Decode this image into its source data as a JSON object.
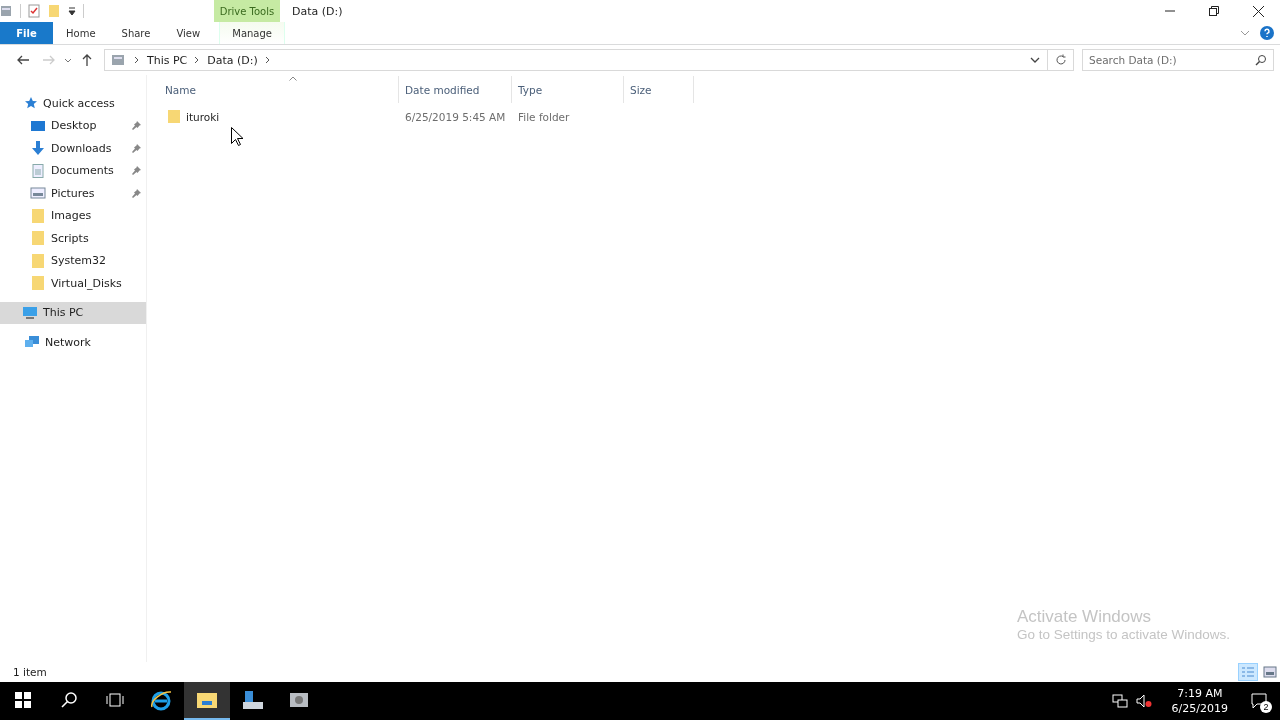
{
  "window": {
    "title": "Data (D:)",
    "context_group": "Drive Tools"
  },
  "tabs": [
    {
      "label": "File",
      "kind": "file",
      "selected": false
    },
    {
      "label": "Home",
      "kind": "plain",
      "selected": false
    },
    {
      "label": "Share",
      "kind": "plain",
      "selected": false
    },
    {
      "label": "View",
      "kind": "plain",
      "selected": false
    },
    {
      "label": "Manage",
      "kind": "context",
      "selected": false
    }
  ],
  "address": {
    "crumbs": [
      "This PC",
      "Data (D:)"
    ]
  },
  "search": {
    "placeholder": "Search Data (D:)"
  },
  "sidebar": {
    "items": [
      {
        "label": "Quick access",
        "kind": "star",
        "selected": false,
        "children": [
          {
            "label": "Desktop",
            "kind": "desktop",
            "pinned": true,
            "selected": false
          },
          {
            "label": "Downloads",
            "kind": "download",
            "pinned": true,
            "selected": false
          },
          {
            "label": "Documents",
            "kind": "document",
            "pinned": true,
            "selected": false
          },
          {
            "label": "Pictures",
            "kind": "picture",
            "pinned": true,
            "selected": false
          },
          {
            "label": "Images",
            "kind": "folder",
            "pinned": false,
            "selected": false
          },
          {
            "label": "Scripts",
            "kind": "folder",
            "pinned": false,
            "selected": false
          },
          {
            "label": "System32",
            "kind": "folder",
            "pinned": false,
            "selected": false
          },
          {
            "label": "Virtual_Disks",
            "kind": "folder",
            "pinned": false,
            "selected": false
          }
        ]
      },
      {
        "label": "This PC",
        "kind": "pc",
        "selected": true
      },
      {
        "label": "Network",
        "kind": "network",
        "selected": false
      }
    ]
  },
  "table": {
    "columns": [
      "Name",
      "Date modified",
      "Type",
      "Size"
    ],
    "rows": [
      {
        "name": "ituroki",
        "date": "6/25/2019 5:45 AM",
        "type": "File folder"
      }
    ]
  },
  "status_bar": {
    "count": "1 item",
    "views": [
      {
        "kind": "details",
        "selected": true
      },
      {
        "kind": "large",
        "selected": false
      }
    ]
  },
  "activation": {
    "title": "Activate Windows",
    "text": "Go to Settings to activate Windows."
  },
  "taskbar": {
    "apps": [
      {
        "kind": "start",
        "active": false
      },
      {
        "kind": "search",
        "active": false
      },
      {
        "kind": "taskview",
        "active": false
      },
      {
        "kind": "ie",
        "active": false
      },
      {
        "kind": "explorer",
        "active": true
      },
      {
        "kind": "server",
        "active": false
      },
      {
        "kind": "tools",
        "active": false
      }
    ],
    "time": "7:19 AM",
    "date": "6/25/2019",
    "notifications": "2"
  }
}
